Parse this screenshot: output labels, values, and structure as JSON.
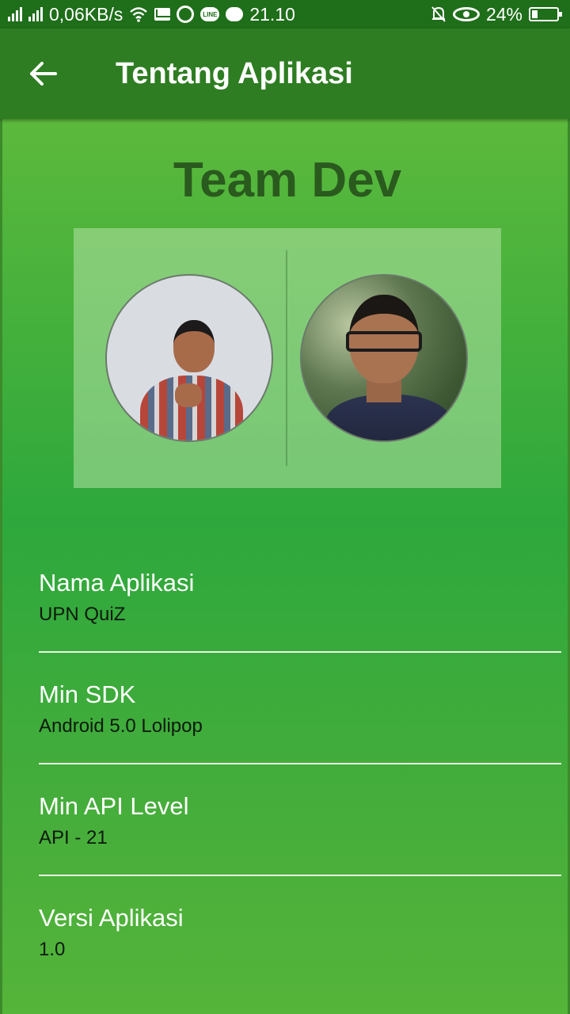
{
  "status_bar": {
    "network_speed": "0,06KB/s",
    "time": "21.10",
    "battery": "24%",
    "battery_level": 0.24,
    "icons": [
      "signal-icon",
      "signal-icon",
      "wifi-icon",
      "mail-icon",
      "whatsapp-icon",
      "line-icon",
      "chat-icon",
      "mute-bell-icon",
      "eye-icon",
      "battery-icon"
    ],
    "line_badge": "LINE"
  },
  "app_bar": {
    "title": "Tentang Aplikasi",
    "back_icon": "arrow-left-icon"
  },
  "team": {
    "title": "Team Dev",
    "members": [
      {
        "avatar": "member-photo-1"
      },
      {
        "avatar": "member-photo-2"
      }
    ]
  },
  "info": {
    "items": [
      {
        "label": "Nama Aplikasi",
        "value": "UPN QuiZ"
      },
      {
        "label": "Min SDK",
        "value": "Android 5.0 Lolipop"
      },
      {
        "label": "Min API Level",
        "value": "API - 21"
      },
      {
        "label": "Versi Aplikasi",
        "value": "1.0"
      }
    ]
  },
  "colors": {
    "status_bar": "#1f6e1a",
    "app_bar": "#2e7d22",
    "content_green": "#3aae3c",
    "team_title": "#2a5a1e"
  }
}
